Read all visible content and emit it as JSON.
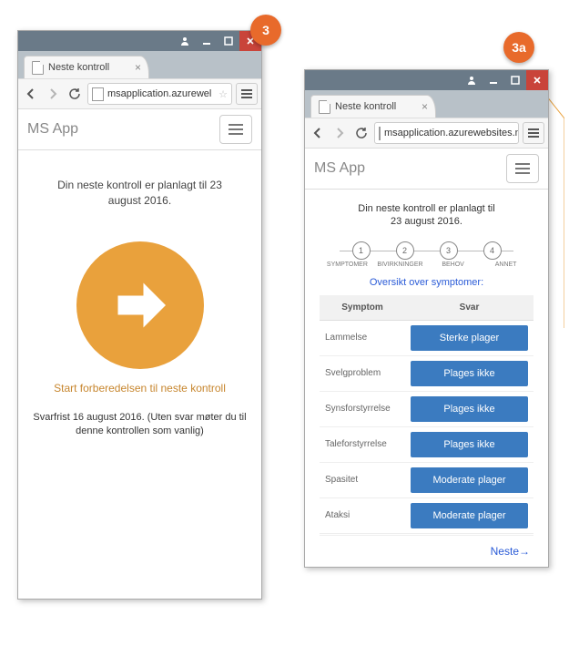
{
  "callouts": {
    "c3": "3",
    "c3a": "3a"
  },
  "window": {
    "tab_title": "Neste kontroll",
    "url_left": "msapplication.azurewel",
    "url_right": "msapplication.azurewebsites.net/surve"
  },
  "app": {
    "title": "MS App"
  },
  "left_page": {
    "planned": "Din neste kontroll er planlagt til 23 august 2016.",
    "start_label": "Start forberedelsen til neste kontroll",
    "deadline": "Svarfrist 16 august 2016. (Uten svar møter du til denne kontrollen som vanlig)"
  },
  "right_page": {
    "planned_line1": "Din neste kontroll er planlagt til",
    "planned_line2": "23 august 2016.",
    "steps": [
      "1",
      "2",
      "3",
      "4"
    ],
    "step_labels": [
      "SYMPTOMER",
      "BIVIRKNINGER",
      "BEHOV",
      "ANNET"
    ],
    "overview": "Oversikt over symptomer:",
    "table": {
      "head_symptom": "Symptom",
      "head_answer": "Svar",
      "rows": [
        {
          "symptom": "Lammelse",
          "answer": "Sterke plager"
        },
        {
          "symptom": "Svelgproblem",
          "answer": "Plages ikke"
        },
        {
          "symptom": "Synsforstyrrelse",
          "answer": "Plages ikke"
        },
        {
          "symptom": "Taleforstyrrelse",
          "answer": "Plages ikke"
        },
        {
          "symptom": "Spasitet",
          "answer": "Moderate plager"
        },
        {
          "symptom": "Ataksi",
          "answer": "Moderate plager"
        }
      ]
    },
    "next": "Neste→"
  }
}
